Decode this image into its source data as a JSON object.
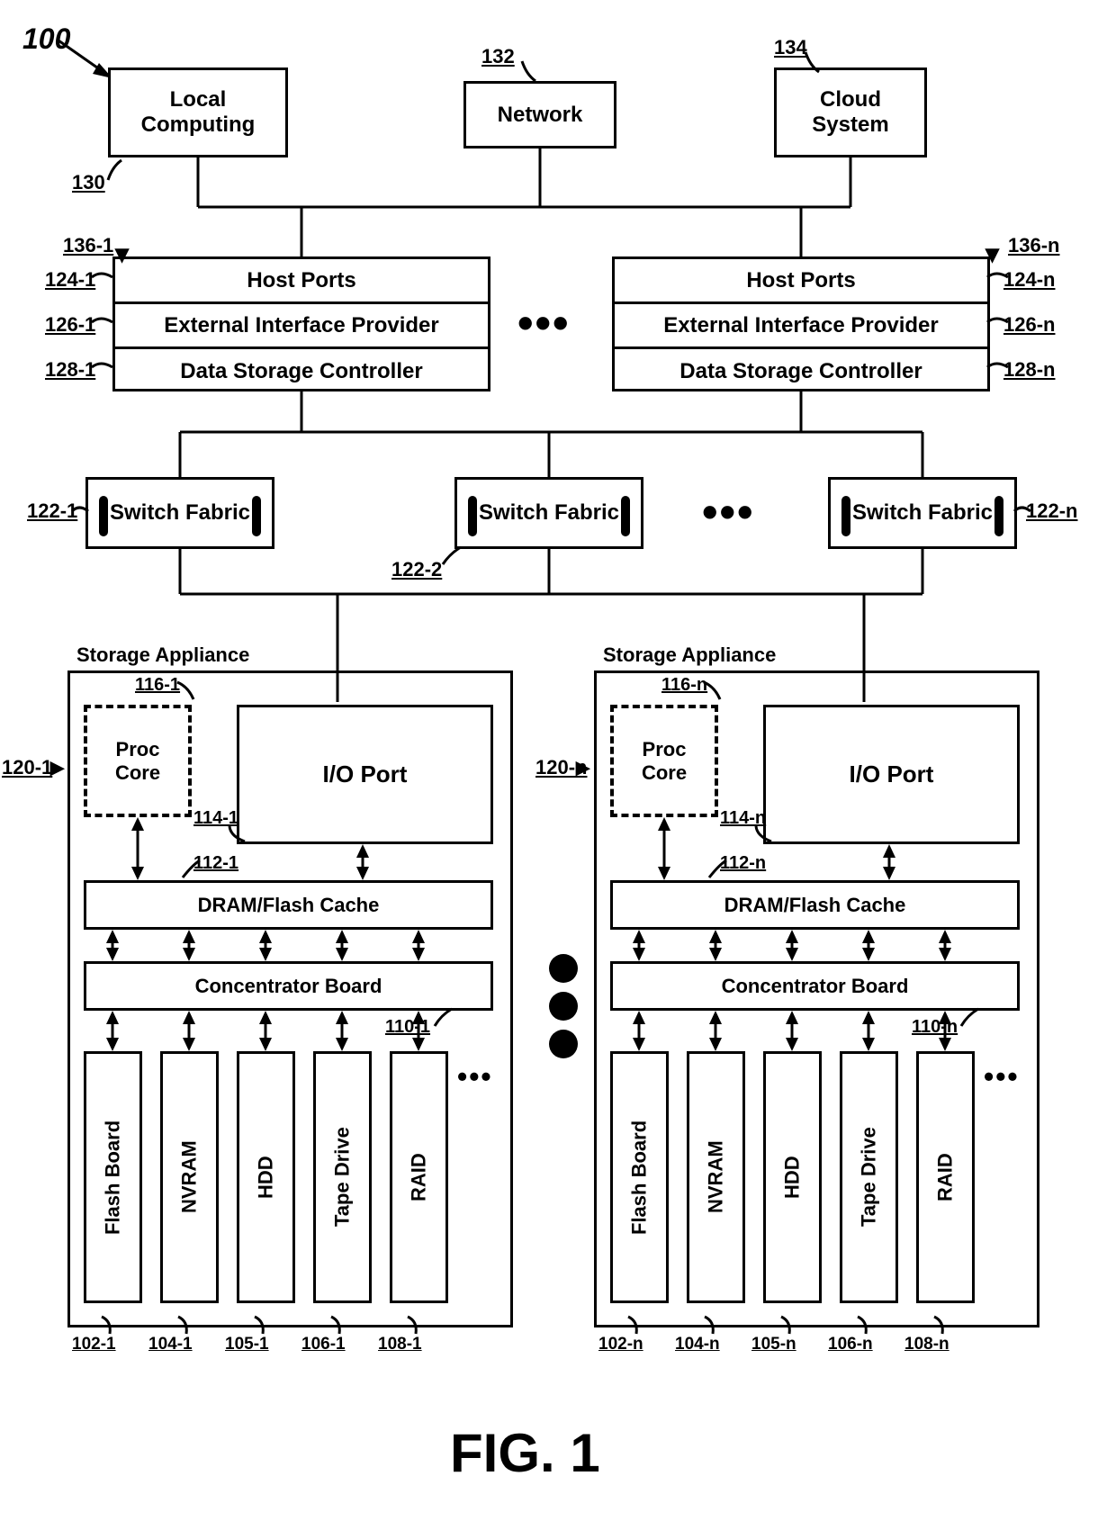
{
  "figure_ref": "100",
  "figure_caption": "FIG. 1",
  "top_systems": {
    "local": "Local\nComputing",
    "network": "Network",
    "cloud": "Cloud\nSystem"
  },
  "controller": {
    "ref1": "136-1",
    "refn": "136-n",
    "host_ports": "Host Ports",
    "ext_if": "External Interface Provider",
    "dsc": "Data Storage Controller",
    "hp_ref1": "124-1",
    "hp_refn": "124-n",
    "ext_ref1": "126-1",
    "ext_refn": "126-n",
    "dsc_ref1": "128-1",
    "dsc_refn": "128-n"
  },
  "switch": {
    "label": "Switch Fabric",
    "ref1": "122-1",
    "ref2": "122-2",
    "refn": "122-n"
  },
  "appliance": {
    "title": "Storage Appliance",
    "ref1": "120-1",
    "refn": "120-n",
    "proc": "Proc\nCore",
    "proc_ref1": "116-1",
    "proc_refn": "116-n",
    "ioport": "I/O Port",
    "ioport_ref1": "114-1",
    "ioport_refn": "114-n",
    "cache": "DRAM/Flash Cache",
    "cache_ref1": "112-1",
    "cache_refn": "112-n",
    "conc": "Concentrator Board",
    "conc_ref1": "110-1",
    "conc_refn": "110-n",
    "storage": {
      "flash": "Flash Board",
      "flash_ref1": "102-1",
      "flash_refn": "102-n",
      "nvram": "NVRAM",
      "nvram_ref1": "104-1",
      "nvram_refn": "104-n",
      "hdd": "HDD",
      "hdd_ref1": "105-1",
      "hdd_refn": "105-n",
      "tape": "Tape Drive",
      "tape_ref1": "106-1",
      "tape_refn": "106-n",
      "raid": "RAID",
      "raid_ref1": "108-1",
      "raid_refn": "108-n"
    }
  },
  "refs": {
    "r130": "130",
    "r132": "132",
    "r134": "134"
  }
}
